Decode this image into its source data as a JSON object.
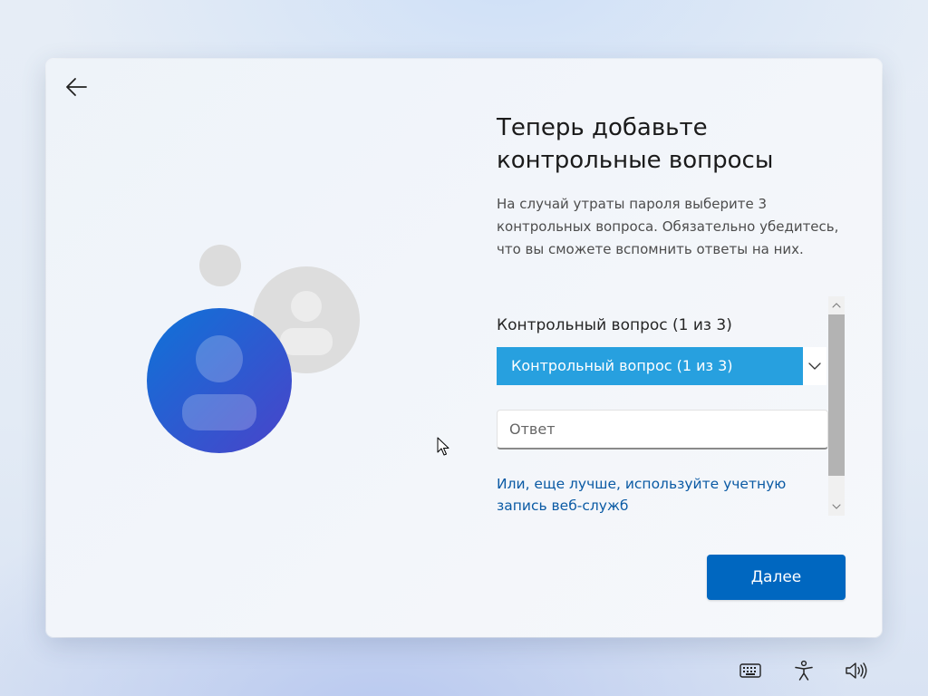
{
  "dialog": {
    "title": "Теперь добавьте контрольные вопросы",
    "description": "На случай утраты пароля выберите 3 контрольных вопроса. Обязательно убедитесь, что вы сможете вспомнить ответы на них.",
    "question_label": "Контрольный вопрос (1 из 3)",
    "question_select_value": "Контрольный вопрос (1 из 3)",
    "answer_placeholder": "Ответ",
    "alt_link": "Или, еще лучше, используйте учетную запись веб-служб",
    "next_button": "Далее"
  },
  "icons": {
    "back": "arrow-left-icon",
    "chevron": "chevron-down-icon",
    "keyboard": "keyboard-icon",
    "accessibility": "accessibility-icon",
    "volume": "volume-icon"
  },
  "colors": {
    "accent": "#0067c0",
    "select_highlight": "#27a0df",
    "link": "#0a5aa4",
    "avatar_primary": "#1f63d2",
    "avatar_secondary": "#dedede"
  }
}
